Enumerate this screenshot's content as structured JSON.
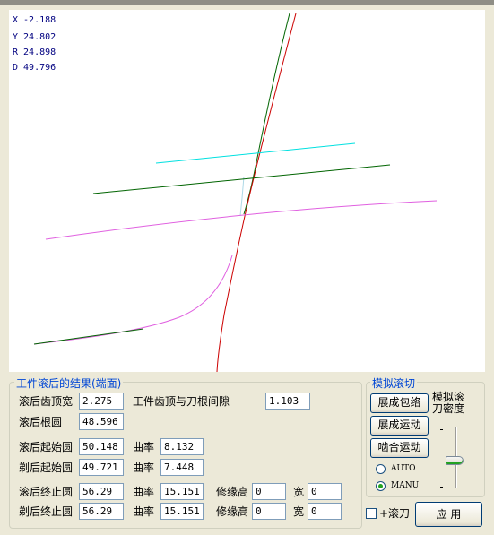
{
  "readout": {
    "x": "X -2.188",
    "y": "Y 24.802",
    "r": "R 24.898",
    "d": "D 49.796"
  },
  "colors": {
    "workpiece": "#cc0000",
    "profile": "#006400",
    "cutter_tip": "#00e0e0",
    "root_arc": "#e060e0"
  },
  "results": {
    "title": "工件滚后的结果(端面)",
    "top_width_label": "滚后齿顶宽",
    "top_width_value": "2.275",
    "clearance_label": "工件齿顶与刀根间隙",
    "clearance_value": "1.103",
    "root_circle_label": "滚后根圆",
    "root_circle_value": "48.596",
    "hob_start_label": "滚后起始圆",
    "hob_start_value": "50.148",
    "hob_start_curv_label": "曲率",
    "hob_start_curv_value": "8.132",
    "shave_start_label": "剃后起始圆",
    "shave_start_value": "49.721",
    "shave_start_curv_label": "曲率",
    "shave_start_curv_value": "7.448",
    "hob_end_label": "滚后终止圆",
    "hob_end_value": "56.29",
    "hob_end_curv_label": "曲率",
    "hob_end_curv_value": "15.151",
    "hob_end_mod_label": "修缘高",
    "hob_end_mod_value": "0",
    "hob_end_width_label": "宽",
    "hob_end_width_value": "0",
    "shave_end_label": "剃后终止圆",
    "shave_end_value": "56.29",
    "shave_end_curv_label": "曲率",
    "shave_end_curv_value": "15.151",
    "shave_end_mod_label": "修缘高",
    "shave_end_mod_value": "0",
    "shave_end_width_label": "宽",
    "shave_end_width_value": "0"
  },
  "simulation": {
    "title": "模拟滚切",
    "envelope_button": "展成包络",
    "motion_button": "展成运动",
    "mesh_button": "啮合运动",
    "density_label_1": "模拟滚",
    "density_label_2": "刀密度",
    "auto_label": "AUTO",
    "manu_label": "MANU",
    "selected_mode": "MANU",
    "density_level": 0.45
  },
  "footer": {
    "hob_checkbox_label": "+滚刀",
    "hob_checked": false,
    "apply_button": "应 用"
  }
}
